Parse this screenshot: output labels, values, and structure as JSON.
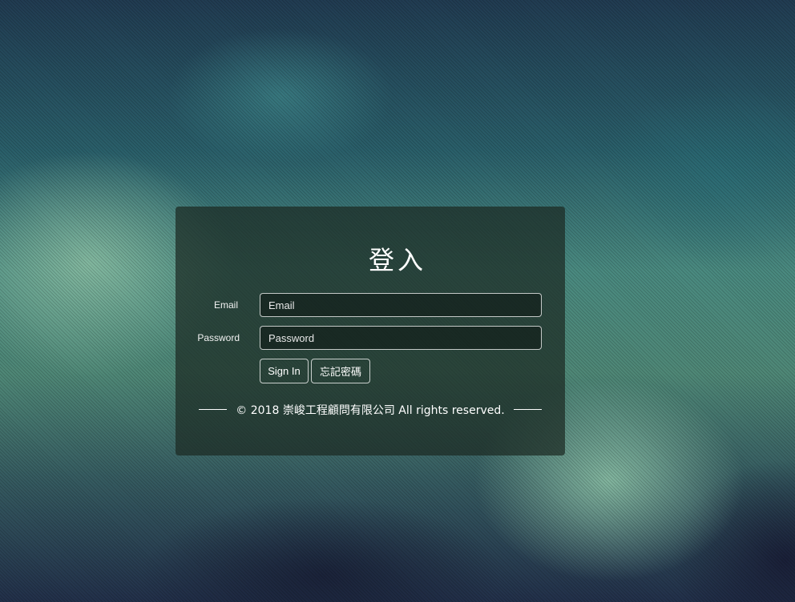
{
  "login": {
    "title": "登入",
    "email_label": "Email",
    "email_placeholder": "Email",
    "password_label": "Password",
    "password_placeholder": "Password",
    "signin_label": "Sign In",
    "forgot_label": "忘記密碼",
    "footer_text": "© 2018 崇峻工程顧問有限公司 All rights reserved."
  }
}
